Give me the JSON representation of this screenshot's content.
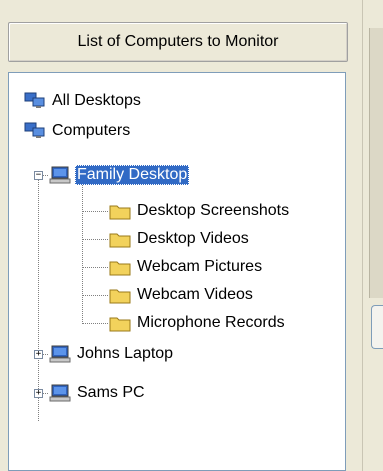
{
  "header": {
    "title": "List of Computers to Monitor"
  },
  "tree": {
    "all_desktops": "All Desktops",
    "computers": "Computers",
    "family_desktop": {
      "label": "Family Desktop",
      "children": [
        "Desktop Screenshots",
        "Desktop Videos",
        "Webcam Pictures",
        "Webcam Videos",
        "Microphone Records"
      ]
    },
    "johns_laptop": "Johns Laptop",
    "sams_pc": "Sams PC"
  },
  "colors": {
    "selection": "#316ac5",
    "folder": "#f2d25c",
    "window_bg": "#ece9d8"
  },
  "icons": {
    "group": "monitors-group-icon",
    "computer": "computer-icon",
    "folder": "folder-icon",
    "expanded": "minus-toggle",
    "collapsed": "plus-toggle"
  }
}
